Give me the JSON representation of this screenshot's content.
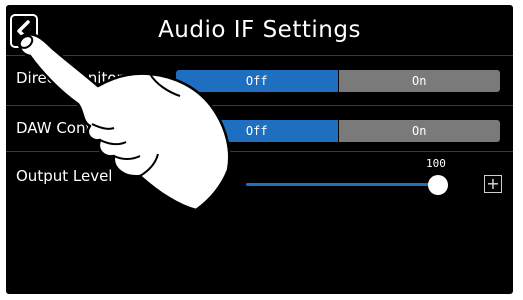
{
  "header": {
    "title": "Audio IF Settings",
    "back_icon": "chevron-left-icon"
  },
  "rows": [
    {
      "label": "Direct Monitor",
      "options": [
        "Off",
        "On"
      ],
      "selected": "Off"
    },
    {
      "label": "DAW Control",
      "options": [
        "Off",
        "On"
      ],
      "selected": "Off"
    }
  ],
  "output_level": {
    "label": "Output Level",
    "value": "100",
    "value_fraction": 1.0,
    "minus_icon": "minus-icon",
    "plus_icon": "plus-icon",
    "plus_symbol": "+"
  },
  "colors": {
    "background": "#000000",
    "selected": "#1f6fc0",
    "unselected": "#7a7a7a",
    "text": "#ffffff"
  }
}
